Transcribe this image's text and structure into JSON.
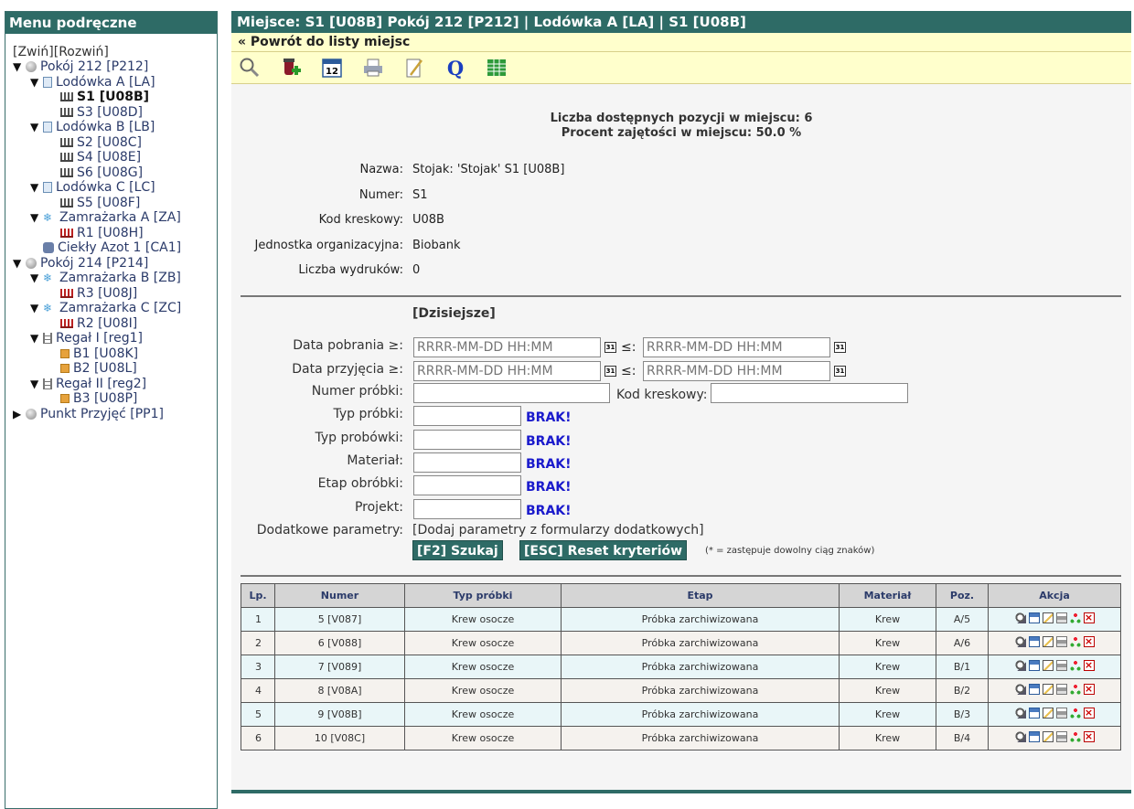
{
  "sidebar": {
    "title": "Menu podręczne",
    "collapse": "[Zwiń]",
    "expand": "[Rozwiń]",
    "tree": [
      {
        "toggle": "▼",
        "icon": "room",
        "label": "Pokój 212 [P212]",
        "level": 0
      },
      {
        "toggle": "▼",
        "icon": "fridge",
        "label": "Lodówka A [LA]",
        "level": 1
      },
      {
        "toggle": "",
        "icon": "rack",
        "label": "S1 [U08B]",
        "level": 2,
        "current": true
      },
      {
        "toggle": "",
        "icon": "rack",
        "label": "S3 [U08D]",
        "level": 2
      },
      {
        "toggle": "▼",
        "icon": "fridge",
        "label": "Lodówka B [LB]",
        "level": 1
      },
      {
        "toggle": "",
        "icon": "rack",
        "label": "S2 [U08C]",
        "level": 2
      },
      {
        "toggle": "",
        "icon": "rack",
        "label": "S4 [U08E]",
        "level": 2
      },
      {
        "toggle": "",
        "icon": "rack",
        "label": "S6 [U08G]",
        "level": 2
      },
      {
        "toggle": "▼",
        "icon": "fridge",
        "label": "Lodówka C [LC]",
        "level": 1
      },
      {
        "toggle": "",
        "icon": "rack",
        "label": "S5 [U08F]",
        "level": 2
      },
      {
        "toggle": "▼",
        "icon": "freezer",
        "label": "Zamrażarka A [ZA]",
        "level": 1
      },
      {
        "toggle": "",
        "icon": "rackred",
        "label": "R1 [U08H]",
        "level": 2
      },
      {
        "toggle": "",
        "icon": "azot",
        "label": "Ciekły Azot 1 [CA1]",
        "level": 1
      },
      {
        "toggle": "▼",
        "icon": "room",
        "label": "Pokój 214 [P214]",
        "level": 0
      },
      {
        "toggle": "▼",
        "icon": "freezer",
        "label": "Zamrażarka B [ZB]",
        "level": 1
      },
      {
        "toggle": "",
        "icon": "rackred",
        "label": "R3 [U08J]",
        "level": 2
      },
      {
        "toggle": "▼",
        "icon": "freezer",
        "label": "Zamrażarka C [ZC]",
        "level": 1
      },
      {
        "toggle": "",
        "icon": "rackred",
        "label": "R2 [U08I]",
        "level": 2
      },
      {
        "toggle": "▼",
        "icon": "shelf",
        "label": "Regał I [reg1]",
        "level": 1
      },
      {
        "toggle": "",
        "icon": "box",
        "label": "B1 [U08K]",
        "level": 2
      },
      {
        "toggle": "",
        "icon": "box",
        "label": "B2 [U08L]",
        "level": 2
      },
      {
        "toggle": "▼",
        "icon": "shelf",
        "label": "Regał II [reg2]",
        "level": 1
      },
      {
        "toggle": "",
        "icon": "box",
        "label": "B3 [U08P]",
        "level": 2
      },
      {
        "toggle": "▶",
        "icon": "room",
        "label": "Punkt Przyjęć [PP1]",
        "level": 0
      }
    ]
  },
  "header": {
    "title": "Miejsce: S1 [U08B] Pokój 212 [P212] | Lodówka A [LA] | S1 [U08B]",
    "back_link": "« Powrót do listy miejsc"
  },
  "toolbar": [
    "search-icon",
    "add-sample-icon",
    "calendar-icon",
    "print-icon",
    "edit-icon",
    "query-icon",
    "spreadsheet-icon"
  ],
  "summary": {
    "available": "Liczba dostępnych pozycji w miejscu: 6",
    "occupancy": "Procent zajętości w miejscu: 50.0 %"
  },
  "info": {
    "name_label": "Nazwa:",
    "name_value": "Stojak: 'Stojak' S1 [U08B]",
    "number_label": "Numer:",
    "number_value": "S1",
    "barcode_label": "Kod kreskowy:",
    "barcode_value": "U08B",
    "org_label": "Jednostka organizacyjna:",
    "org_value": "Biobank",
    "prints_label": "Liczba wydruków:",
    "prints_value": "0"
  },
  "form": {
    "today_link": "[Dzisiejsze]",
    "date_collected_label": "Data pobrania ≥:",
    "date_received_label": "Data przyjęcia ≥:",
    "date_placeholder": "RRRR-MM-DD HH:MM",
    "le": "≤:",
    "sample_number_label": "Numer próbki:",
    "barcode_label": "Kod kreskowy:",
    "sample_type_label": "Typ próbki:",
    "tube_type_label": "Typ probówki:",
    "material_label": "Materiał:",
    "stage_label": "Etap obróbki:",
    "project_label": "Projekt:",
    "brak": "BRAK!",
    "extra_label": "Dodatkowe parametry:",
    "extra_link": "[Dodaj parametry z formularzy dodatkowych]",
    "search_button": "[F2] Szukaj",
    "reset_button": "[ESC] Reset kryteriów",
    "hint": "(* = zastępuje dowolny ciąg znaków)"
  },
  "table": {
    "headers": [
      "Lp.",
      "Numer",
      "Typ próbki",
      "Etap",
      "Materiał",
      "Poz.",
      "Akcja"
    ],
    "rows": [
      [
        "1",
        "5 [V087]",
        "Krew osocze",
        "Próbka zarchiwizowana",
        "Krew",
        "A/5"
      ],
      [
        "2",
        "6 [V088]",
        "Krew osocze",
        "Próbka zarchiwizowana",
        "Krew",
        "A/6"
      ],
      [
        "3",
        "7 [V089]",
        "Krew osocze",
        "Próbka zarchiwizowana",
        "Krew",
        "B/1"
      ],
      [
        "4",
        "8 [V08A]",
        "Krew osocze",
        "Próbka zarchiwizowana",
        "Krew",
        "B/2"
      ],
      [
        "5",
        "9 [V08B]",
        "Krew osocze",
        "Próbka zarchiwizowana",
        "Krew",
        "B/3"
      ],
      [
        "6",
        "10 [V08C]",
        "Krew osocze",
        "Próbka zarchiwizowana",
        "Krew",
        "B/4"
      ]
    ]
  },
  "colors": {
    "header": "#2e6b66",
    "toolbar": "#ffffcc",
    "brak": "#1a1acc"
  }
}
